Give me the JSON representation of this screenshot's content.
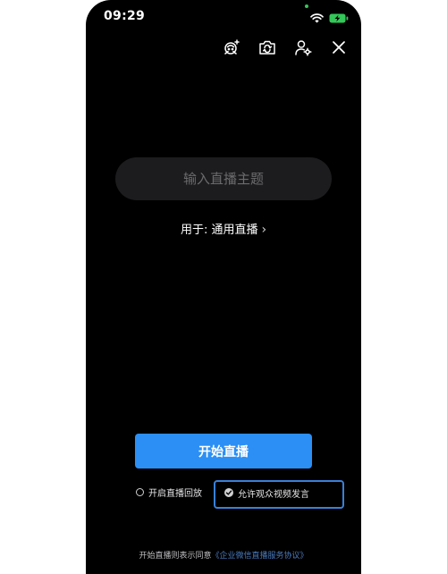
{
  "status_bar": {
    "time": "09:29"
  },
  "toolbar": {
    "icons": [
      "beauty-icon",
      "flip-camera-icon",
      "user-settings-icon",
      "close-icon"
    ]
  },
  "topic_input": {
    "placeholder": "输入直播主题",
    "value": ""
  },
  "usage": {
    "label": "用于: 通用直播",
    "chevron": "›"
  },
  "start_button": {
    "label": "开始直播"
  },
  "options": {
    "replay_label": "开启直播回放",
    "replay_checked": false,
    "speech_label": "允许观众视频发言",
    "speech_checked": true
  },
  "agreement": {
    "prefix": "开始直播则表示同意",
    "link": "《企业微信直播服务协议》"
  },
  "colors": {
    "accent": "#2b8ff5",
    "background": "#000000",
    "input_bg": "#1c1c1e",
    "link": "#4a7bbf",
    "highlight_border": "#3a80d9",
    "battery": "#34c759"
  }
}
